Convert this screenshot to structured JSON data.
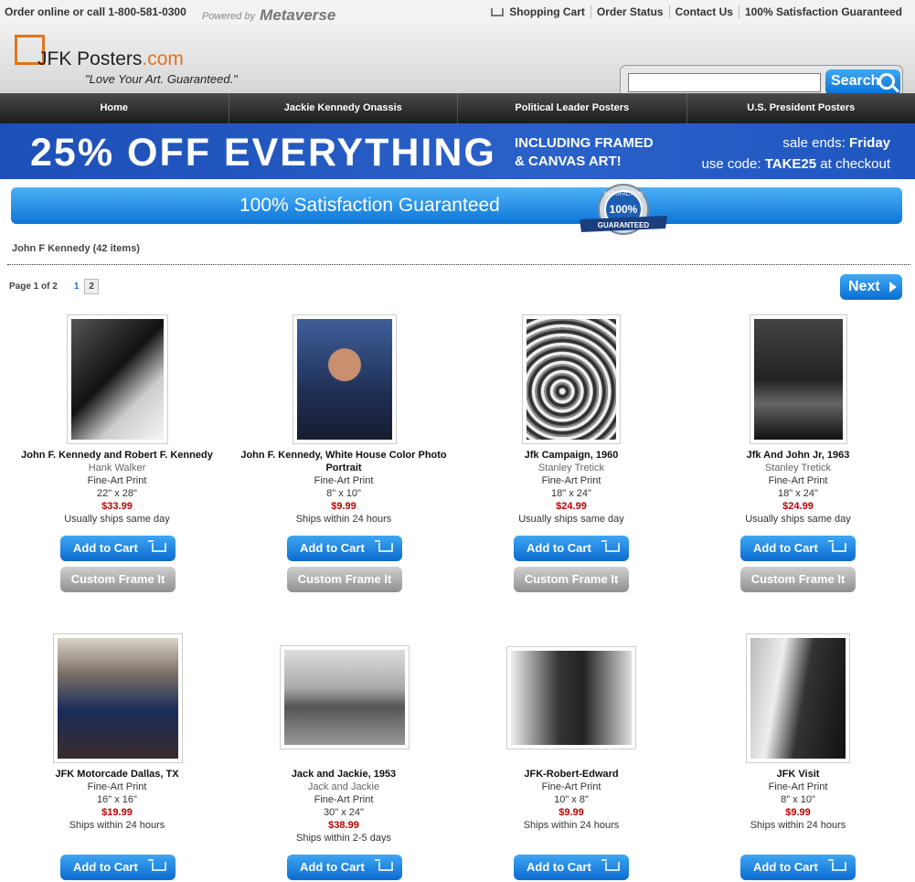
{
  "topbar": {
    "phone": "Order online or call 1-800-581-0300",
    "powered_by": "Powered by",
    "brand": "Metaverse",
    "links": [
      "Shopping Cart",
      "Order Status",
      "Contact Us",
      "100% Satisfaction Guaranteed"
    ]
  },
  "header": {
    "logo": "JFK Posters",
    "logo_suffix": ".com",
    "tagline": "\"Love Your Art. Guaranteed.\"",
    "search_value": "",
    "search_button": "Search"
  },
  "nav": [
    "Home",
    "Jackie Kennedy Onassis",
    "Political Leader Posters",
    "U.S. President Posters"
  ],
  "sale": {
    "headline": "25% OFF EVERYTHING",
    "sub1": "INCLUDING FRAMED",
    "sub2": "& CANVAS ART!",
    "ends_label": "sale ends:",
    "ends_day": "Friday",
    "code_label": "use code:",
    "code": "TAKE25",
    "code_suffix": "at checkout"
  },
  "satisfaction": {
    "text": "100% Satisfaction Guaranteed",
    "seal_top": "SATISFACTION",
    "seal_mid": "100%",
    "seal_ribbon": "GUARANTEED"
  },
  "category": "John F Kennedy (42 items)",
  "pager": {
    "label": "Page 1 of 2",
    "page1": "1",
    "page2": "2",
    "next": "Next"
  },
  "buttons": {
    "add": "Add to Cart",
    "frame": "Custom Frame It"
  },
  "products": [
    {
      "name": "John F. Kennedy and Robert F. Kennedy",
      "artist": "Hank Walker",
      "type": "Fine-Art Print",
      "size": "22\" x 28\"",
      "price": "$33.99",
      "ship": "Usually ships same day"
    },
    {
      "name": "John F. Kennedy, White House Color Photo Portrait",
      "artist": "",
      "type": "Fine-Art Print",
      "size": "8\" x 10\"",
      "price": "$9.99",
      "ship": "Ships within 24 hours"
    },
    {
      "name": "Jfk Campaign, 1960",
      "artist": "Stanley Tretick",
      "type": "Fine-Art Print",
      "size": "18\" x 24\"",
      "price": "$24.99",
      "ship": "Usually ships same day"
    },
    {
      "name": "Jfk And John Jr, 1963",
      "artist": "Stanley Tretick",
      "type": "Fine-Art Print",
      "size": "18\" x 24\"",
      "price": "$24.99",
      "ship": "Usually ships same day"
    },
    {
      "name": "JFK Motorcade Dallas, TX",
      "artist": "",
      "type": "Fine-Art Print",
      "size": "16\" x 16\"",
      "price": "$19.99",
      "ship": "Ships within 24 hours"
    },
    {
      "name": "Jack and Jackie, 1953",
      "artist": "Jack and Jackie",
      "type": "Fine-Art Print",
      "size": "30\" x 24\"",
      "price": "$38.99",
      "ship": "Ships within 2-5 days"
    },
    {
      "name": "JFK-Robert-Edward",
      "artist": "",
      "type": "Fine-Art Print",
      "size": "10\" x 8\"",
      "price": "$9.99",
      "ship": "Ships within 24 hours"
    },
    {
      "name": "JFK Visit",
      "artist": "",
      "type": "Fine-Art Print",
      "size": "8\" x 10\"",
      "price": "$9.99",
      "ship": "Ships within 24 hours"
    }
  ]
}
